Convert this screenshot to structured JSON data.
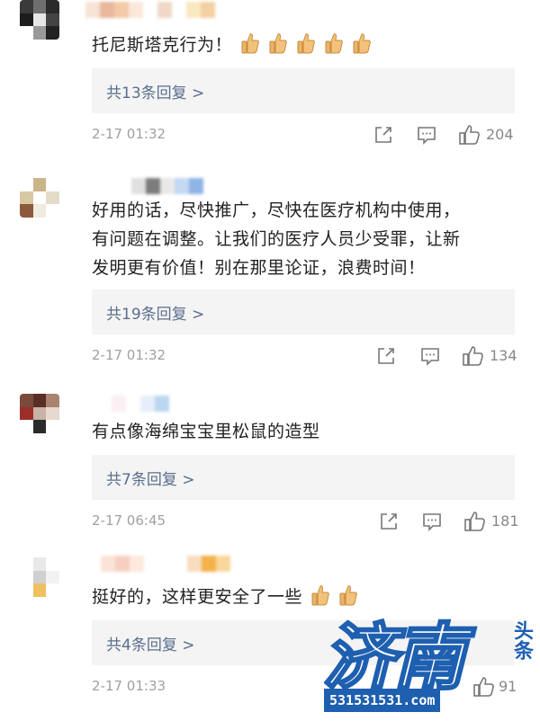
{
  "comments": [
    {
      "text_lines": [
        "托尼斯塔克行为！"
      ],
      "reply_label": "共13条回复 >",
      "time": "2-17 01:32",
      "likes": "204",
      "thumbs": 5
    },
    {
      "text_lines": [
        "好用的话，尽快推广，尽快在医疗机构中使用，",
        "有问题在调整。让我们的医疗人员少受罪，让新",
        "发明更有价值！别在那里论证，浪费时间！"
      ],
      "reply_label": "共19条回复 >",
      "time": "2-17 01:32",
      "likes": "134",
      "thumbs": 0
    },
    {
      "text_lines": [
        "有点像海绵宝宝里松鼠的造型"
      ],
      "reply_label": "共7条回复 >",
      "time": "2-17 06:45",
      "likes": "181",
      "thumbs": 0
    },
    {
      "text_lines": [
        "挺好的，这样更安全了一些"
      ],
      "reply_label": "共4条回复 >",
      "time": "2-17 01:33",
      "likes": "91",
      "thumbs": 2
    }
  ],
  "watermark": {
    "brand_chars": "济南",
    "side_chars": "头条",
    "url": "531531531.com"
  },
  "icons": {
    "share": "share-icon",
    "comment": "comment-icon",
    "like": "like-icon",
    "thumbs": "thumbs-up-emoji-icon"
  },
  "colors": {
    "reply_link": "#5a6e8c",
    "reply_bg": "#f4f4f4",
    "watermark_blue": "#1e5fb0"
  }
}
